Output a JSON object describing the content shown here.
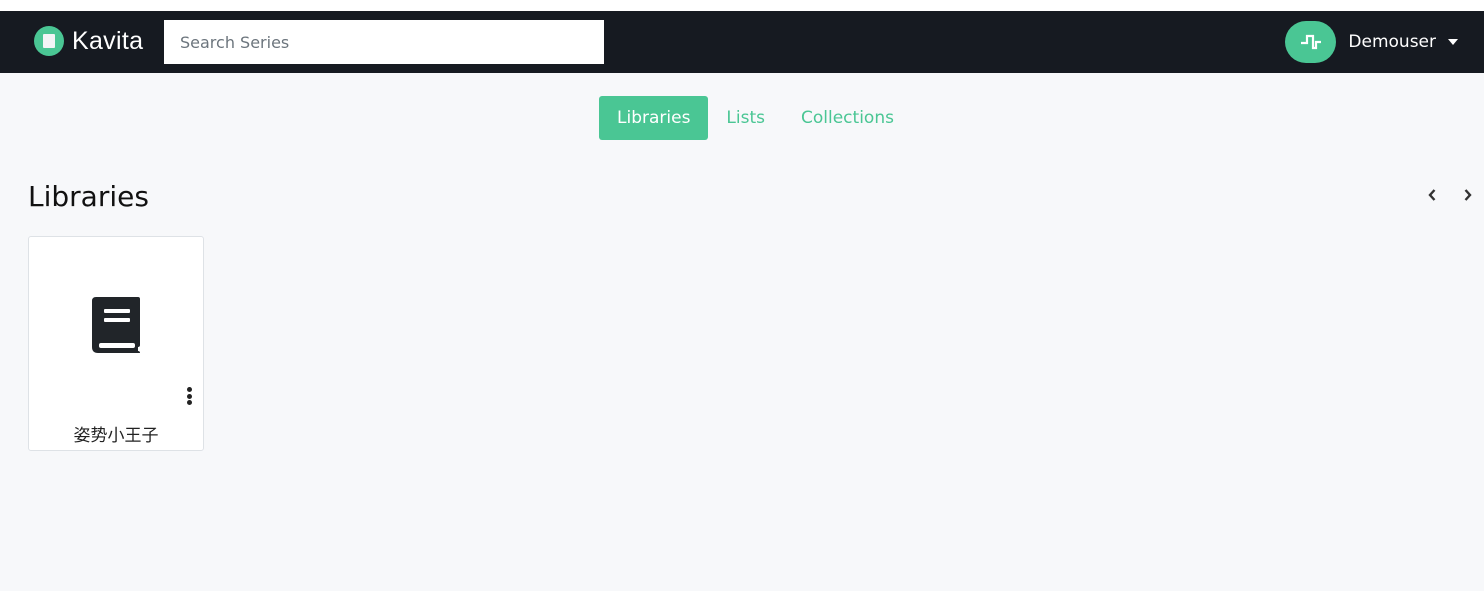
{
  "navbar": {
    "brand": "Kavita",
    "search_placeholder": "Search Series",
    "search_value": "",
    "user_name": "Demouser"
  },
  "tabs": [
    {
      "label": "Libraries",
      "active": true
    },
    {
      "label": "Lists",
      "active": false
    },
    {
      "label": "Collections",
      "active": false
    }
  ],
  "section": {
    "title": "Libraries"
  },
  "libraries": [
    {
      "title": "姿势小王子",
      "icon": "book-icon"
    }
  ],
  "colors": {
    "accent": "#4ac694",
    "navbar_bg": "#161a21",
    "page_bg": "#f7f8fa"
  }
}
